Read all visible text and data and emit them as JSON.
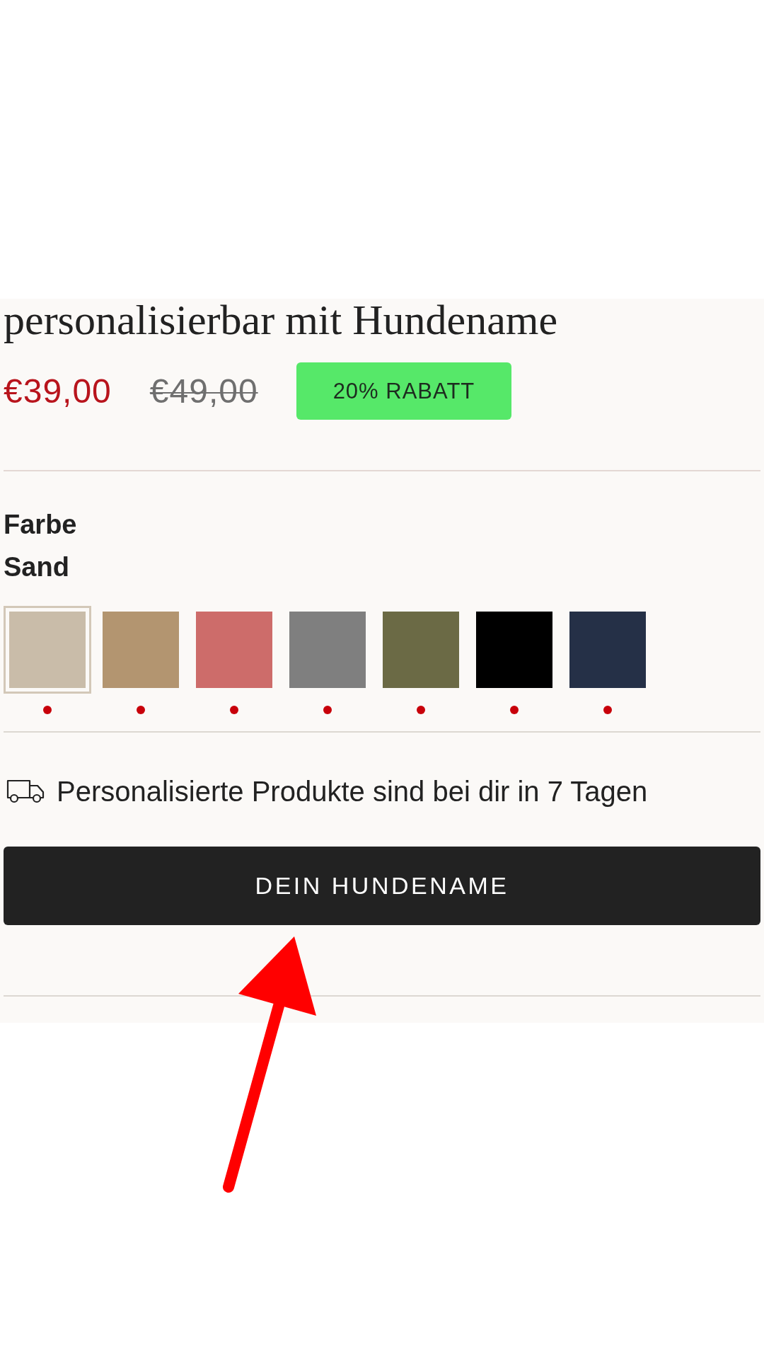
{
  "product": {
    "title": "personalisierbar mit Hundename",
    "price": "€39,00",
    "old_price": "€49,00",
    "discount_badge": "20% RABATT"
  },
  "option": {
    "label": "Farbe",
    "value": "Sand",
    "swatches": [
      {
        "color": "#c9bca9",
        "selected": true,
        "dot": true
      },
      {
        "color": "#b39570",
        "selected": false,
        "dot": true
      },
      {
        "color": "#cd6c6a",
        "selected": false,
        "dot": true
      },
      {
        "color": "#7f7f7f",
        "selected": false,
        "dot": true
      },
      {
        "color": "#6b6a45",
        "selected": false,
        "dot": true
      },
      {
        "color": "#000000",
        "selected": false,
        "dot": true
      },
      {
        "color": "#253047",
        "selected": false,
        "dot": true
      }
    ]
  },
  "delivery_note": {
    "text": "Personalisierte Produkte sind bei dir in 7 Tagen"
  },
  "buttons": [
    {
      "label": "DEIN HUNDENAME"
    }
  ],
  "annotations": [
    {
      "kind": "arrow"
    }
  ]
}
